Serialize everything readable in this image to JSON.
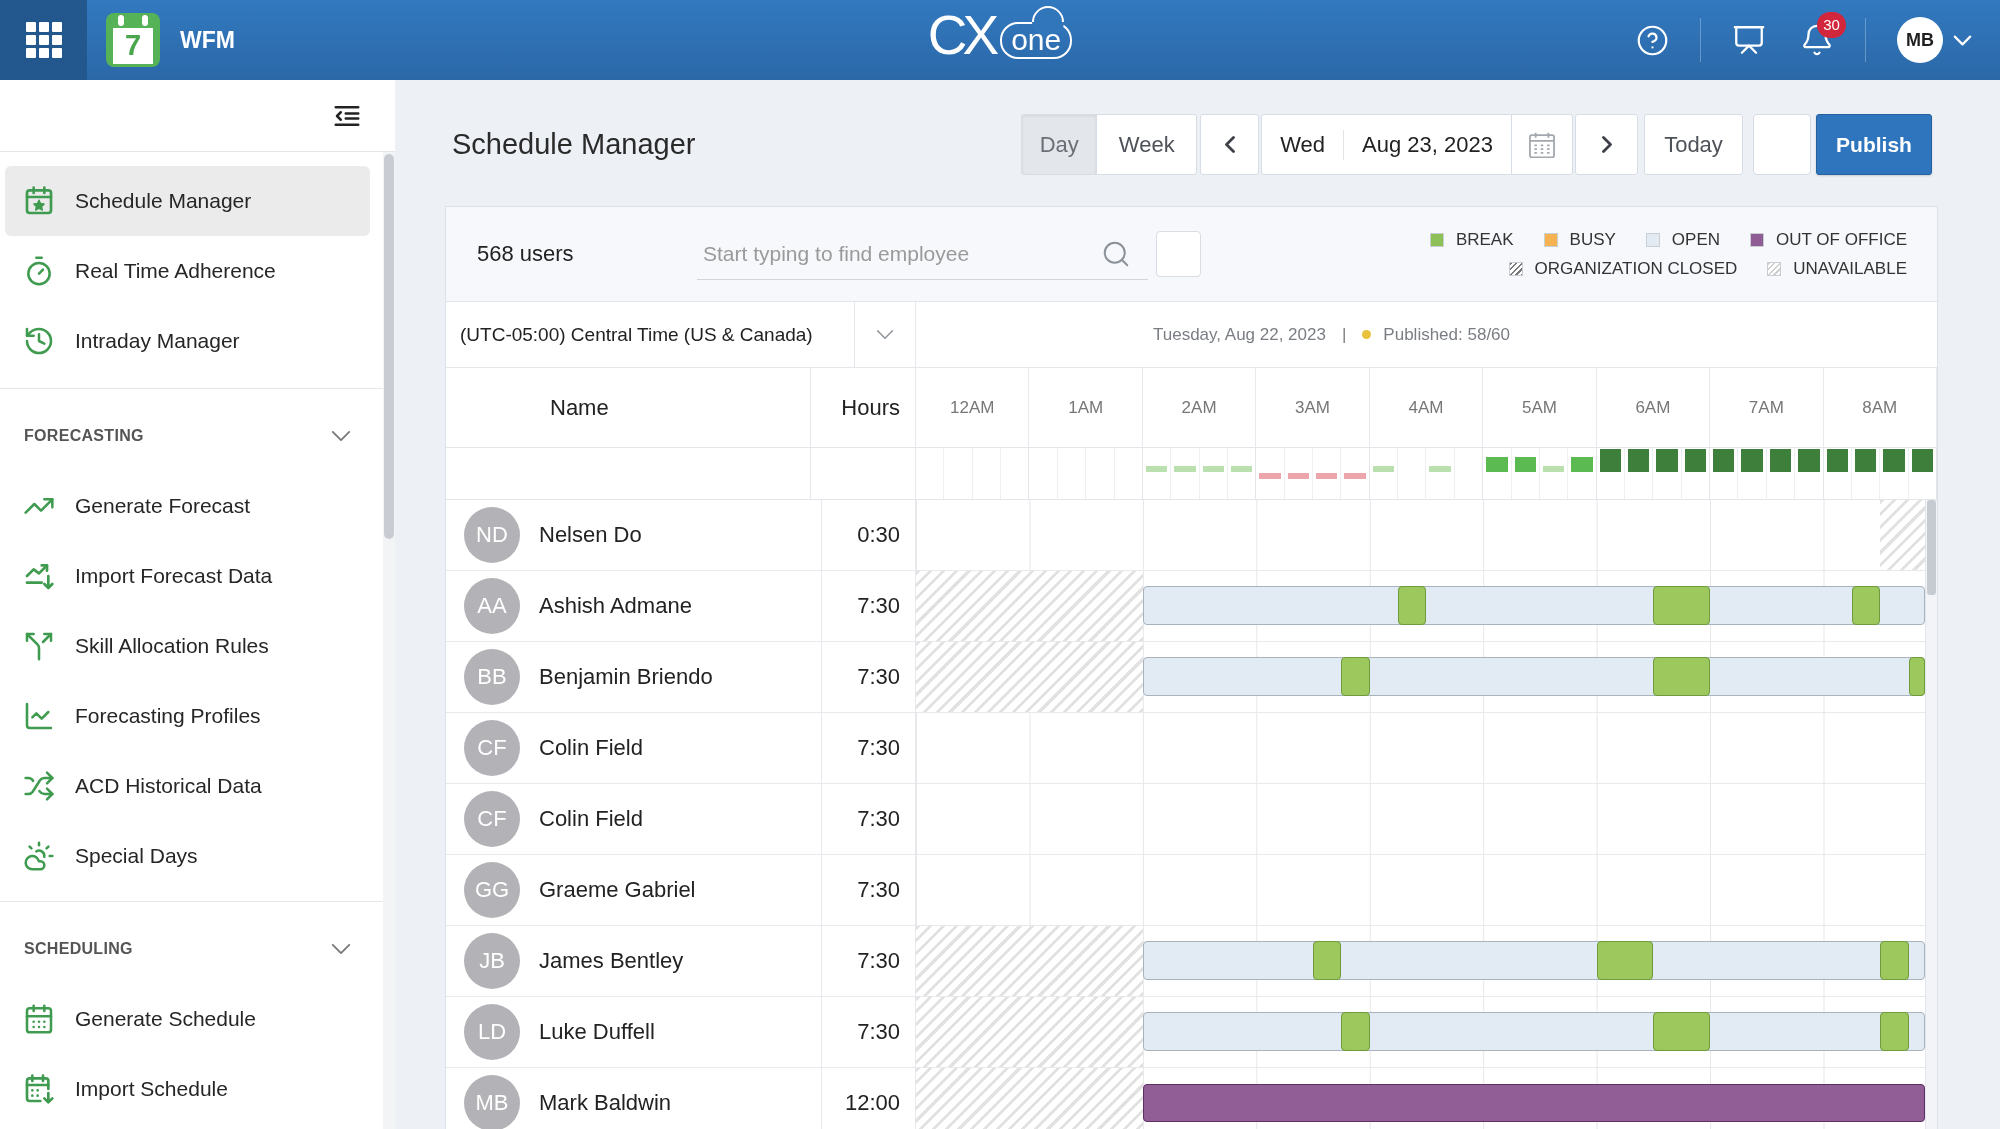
{
  "top_bar": {
    "app_day": "7",
    "app_name": "WFM",
    "logo": {
      "main": "CX",
      "suffix": "one"
    },
    "notifications": "30",
    "user_initials": "MB"
  },
  "sidebar": {
    "items": [
      {
        "label": "Schedule Manager",
        "selected": true
      },
      {
        "label": "Real Time Adherence",
        "selected": false
      },
      {
        "label": "Intraday Manager",
        "selected": false
      }
    ],
    "sections": [
      {
        "title": "FORECASTING",
        "expanded": true,
        "items": [
          {
            "label": "Generate Forecast",
            "selected": false
          },
          {
            "label": "Import Forecast Data",
            "selected": false
          },
          {
            "label": "Skill Allocation Rules",
            "selected": false
          },
          {
            "label": "Forecasting Profiles",
            "selected": false
          },
          {
            "label": "ACD Historical Data",
            "selected": false
          },
          {
            "label": "Special Days",
            "selected": false
          }
        ]
      },
      {
        "title": "SCHEDULING",
        "expanded": true,
        "items": [
          {
            "label": "Generate Schedule",
            "selected": false
          },
          {
            "label": "Import Schedule",
            "selected": false
          }
        ]
      }
    ]
  },
  "page_title": "Schedule Manager",
  "toolbar": {
    "views": [
      {
        "label": "Day",
        "selected": true
      },
      {
        "label": "Week",
        "selected": false
      }
    ],
    "weekday": "Wed",
    "date": "Aug 23, 2023",
    "today": "Today",
    "publish": "Publish"
  },
  "panel": {
    "users_count": "568 users",
    "search": {
      "placeholder": "Start typing to find employee"
    },
    "legend": [
      {
        "label": "BREAK",
        "kind": "solid",
        "color": "#8dc057"
      },
      {
        "label": "BUSY",
        "kind": "solid",
        "color": "#f4b350"
      },
      {
        "label": "OPEN",
        "kind": "solid",
        "color": "#e3eaf2"
      },
      {
        "label": "OUT OF OFFICE",
        "kind": "solid",
        "color": "#8f5c94"
      },
      {
        "label": "ORGANIZATION CLOSED",
        "kind": "hatched",
        "color": "#7a7a7a"
      },
      {
        "label": "UNAVAILABLE",
        "kind": "hatched",
        "color": "#cfcfcf"
      }
    ],
    "timezone": {
      "value": "(UTC-05:00) Central Time (US & Canada)"
    },
    "schedule_date": "Tuesday, Aug 22, 2023",
    "separator": "|",
    "published": "Published: 58/60",
    "columns": {
      "name": "Name",
      "hours": "Hours"
    },
    "hour_labels": [
      "12AM",
      "1AM",
      "2AM",
      "3AM",
      "4AM",
      "5AM",
      "6AM",
      "7AM",
      "8AM"
    ],
    "coverage": [
      {
        "kind": "none"
      },
      {
        "kind": "none"
      },
      {
        "kind": "none"
      },
      {
        "kind": "none"
      },
      {
        "kind": "none"
      },
      {
        "kind": "none"
      },
      {
        "kind": "none"
      },
      {
        "kind": "none"
      },
      {
        "kind": "light"
      },
      {
        "kind": "light"
      },
      {
        "kind": "light"
      },
      {
        "kind": "light"
      },
      {
        "kind": "low"
      },
      {
        "kind": "low"
      },
      {
        "kind": "low"
      },
      {
        "kind": "low"
      },
      {
        "kind": "light"
      },
      {
        "kind": "none"
      },
      {
        "kind": "light"
      },
      {
        "kind": "none"
      },
      {
        "kind": "medium"
      },
      {
        "kind": "medium"
      },
      {
        "kind": "light"
      },
      {
        "kind": "medium"
      },
      {
        "kind": "full"
      },
      {
        "kind": "full"
      },
      {
        "kind": "full"
      },
      {
        "kind": "full"
      },
      {
        "kind": "full"
      },
      {
        "kind": "full"
      },
      {
        "kind": "full"
      },
      {
        "kind": "full"
      },
      {
        "kind": "full"
      },
      {
        "kind": "full"
      },
      {
        "kind": "full"
      },
      {
        "kind": "full"
      }
    ],
    "employees": [
      {
        "initials": "ND",
        "name": "Nelsen Do",
        "hours": "0:30",
        "slots": [
          {
            "kind": "none"
          },
          {
            "kind": "none"
          },
          {
            "kind": "none"
          },
          {
            "kind": "none"
          },
          {
            "kind": "none"
          },
          {
            "kind": "none"
          },
          {
            "kind": "none"
          },
          {
            "kind": "none"
          },
          {
            "kind": "none"
          },
          {
            "kind": "none"
          },
          {
            "kind": "none"
          },
          {
            "kind": "none"
          },
          {
            "kind": "none"
          },
          {
            "kind": "none"
          },
          {
            "kind": "none"
          },
          {
            "kind": "none"
          },
          {
            "kind": "none"
          },
          {
            "kind": "none"
          },
          {
            "kind": "none"
          },
          {
            "kind": "none"
          },
          {
            "kind": "none"
          },
          {
            "kind": "none"
          },
          {
            "kind": "none"
          },
          {
            "kind": "none"
          },
          {
            "kind": "none"
          },
          {
            "kind": "none"
          },
          {
            "kind": "none"
          },
          {
            "kind": "none"
          },
          {
            "kind": "none"
          },
          {
            "kind": "none"
          },
          {
            "kind": "none"
          },
          {
            "kind": "none"
          },
          {
            "kind": "none"
          },
          {
            "kind": "none"
          },
          {
            "kind": "unavailable"
          },
          {
            "kind": "unavailable"
          }
        ]
      },
      {
        "initials": "AA",
        "name": "Ashish Admane",
        "hours": "7:30",
        "slots": [
          {
            "kind": "unavailable"
          },
          {
            "kind": "unavailable"
          },
          {
            "kind": "unavailable"
          },
          {
            "kind": "unavailable"
          },
          {
            "kind": "unavailable"
          },
          {
            "kind": "unavailable"
          },
          {
            "kind": "unavailable"
          },
          {
            "kind": "unavailable"
          },
          {
            "kind": "open"
          },
          {
            "kind": "open"
          },
          {
            "kind": "open"
          },
          {
            "kind": "open"
          },
          {
            "kind": "open"
          },
          {
            "kind": "open"
          },
          {
            "kind": "open"
          },
          {
            "kind": "open"
          },
          {
            "kind": "open"
          },
          {
            "kind": "break"
          },
          {
            "kind": "open"
          },
          {
            "kind": "open"
          },
          {
            "kind": "open"
          },
          {
            "kind": "open"
          },
          {
            "kind": "open"
          },
          {
            "kind": "open"
          },
          {
            "kind": "open"
          },
          {
            "kind": "open"
          },
          {
            "kind": "break"
          },
          {
            "kind": "break"
          },
          {
            "kind": "open"
          },
          {
            "kind": "open"
          },
          {
            "kind": "open"
          },
          {
            "kind": "open"
          },
          {
            "kind": "open"
          },
          {
            "kind": "break"
          },
          {
            "kind": "open"
          },
          {
            "kind": "open"
          }
        ]
      },
      {
        "initials": "BB",
        "name": "Benjamin Briendo",
        "hours": "7:30",
        "slots": [
          {
            "kind": "unavailable"
          },
          {
            "kind": "unavailable"
          },
          {
            "kind": "unavailable"
          },
          {
            "kind": "unavailable"
          },
          {
            "kind": "unavailable"
          },
          {
            "kind": "unavailable"
          },
          {
            "kind": "unavailable"
          },
          {
            "kind": "unavailable"
          },
          {
            "kind": "open"
          },
          {
            "kind": "open"
          },
          {
            "kind": "open"
          },
          {
            "kind": "open"
          },
          {
            "kind": "open"
          },
          {
            "kind": "open"
          },
          {
            "kind": "open"
          },
          {
            "kind": "break"
          },
          {
            "kind": "open"
          },
          {
            "kind": "open"
          },
          {
            "kind": "open"
          },
          {
            "kind": "open"
          },
          {
            "kind": "open"
          },
          {
            "kind": "open"
          },
          {
            "kind": "open"
          },
          {
            "kind": "open"
          },
          {
            "kind": "open"
          },
          {
            "kind": "open"
          },
          {
            "kind": "break"
          },
          {
            "kind": "break"
          },
          {
            "kind": "open"
          },
          {
            "kind": "open"
          },
          {
            "kind": "open"
          },
          {
            "kind": "open"
          },
          {
            "kind": "open"
          },
          {
            "kind": "open"
          },
          {
            "kind": "open"
          },
          {
            "kind": "break"
          }
        ]
      },
      {
        "initials": "CF",
        "name": "Colin Field",
        "hours": "7:30",
        "slots": [
          {
            "kind": "none"
          },
          {
            "kind": "none"
          },
          {
            "kind": "none"
          },
          {
            "kind": "none"
          },
          {
            "kind": "none"
          },
          {
            "kind": "none"
          },
          {
            "kind": "none"
          },
          {
            "kind": "none"
          },
          {
            "kind": "none"
          },
          {
            "kind": "none"
          },
          {
            "kind": "none"
          },
          {
            "kind": "none"
          },
          {
            "kind": "none"
          },
          {
            "kind": "none"
          },
          {
            "kind": "none"
          },
          {
            "kind": "none"
          },
          {
            "kind": "none"
          },
          {
            "kind": "none"
          },
          {
            "kind": "none"
          },
          {
            "kind": "none"
          },
          {
            "kind": "none"
          },
          {
            "kind": "none"
          },
          {
            "kind": "none"
          },
          {
            "kind": "none"
          },
          {
            "kind": "none"
          },
          {
            "kind": "none"
          },
          {
            "kind": "none"
          },
          {
            "kind": "none"
          },
          {
            "kind": "none"
          },
          {
            "kind": "none"
          },
          {
            "kind": "none"
          },
          {
            "kind": "none"
          },
          {
            "kind": "none"
          },
          {
            "kind": "none"
          },
          {
            "kind": "none"
          },
          {
            "kind": "none"
          }
        ]
      },
      {
        "initials": "CF",
        "name": "Colin Field",
        "hours": "7:30",
        "slots": [
          {
            "kind": "none"
          },
          {
            "kind": "none"
          },
          {
            "kind": "none"
          },
          {
            "kind": "none"
          },
          {
            "kind": "none"
          },
          {
            "kind": "none"
          },
          {
            "kind": "none"
          },
          {
            "kind": "none"
          },
          {
            "kind": "none"
          },
          {
            "kind": "none"
          },
          {
            "kind": "none"
          },
          {
            "kind": "none"
          },
          {
            "kind": "none"
          },
          {
            "kind": "none"
          },
          {
            "kind": "none"
          },
          {
            "kind": "none"
          },
          {
            "kind": "none"
          },
          {
            "kind": "none"
          },
          {
            "kind": "none"
          },
          {
            "kind": "none"
          },
          {
            "kind": "none"
          },
          {
            "kind": "none"
          },
          {
            "kind": "none"
          },
          {
            "kind": "none"
          },
          {
            "kind": "none"
          },
          {
            "kind": "none"
          },
          {
            "kind": "none"
          },
          {
            "kind": "none"
          },
          {
            "kind": "none"
          },
          {
            "kind": "none"
          },
          {
            "kind": "none"
          },
          {
            "kind": "none"
          },
          {
            "kind": "none"
          },
          {
            "kind": "none"
          },
          {
            "kind": "none"
          },
          {
            "kind": "none"
          }
        ]
      },
      {
        "initials": "GG",
        "name": "Graeme Gabriel",
        "hours": "7:30",
        "slots": [
          {
            "kind": "none"
          },
          {
            "kind": "none"
          },
          {
            "kind": "none"
          },
          {
            "kind": "none"
          },
          {
            "kind": "none"
          },
          {
            "kind": "none"
          },
          {
            "kind": "none"
          },
          {
            "kind": "none"
          },
          {
            "kind": "none"
          },
          {
            "kind": "none"
          },
          {
            "kind": "none"
          },
          {
            "kind": "none"
          },
          {
            "kind": "none"
          },
          {
            "kind": "none"
          },
          {
            "kind": "none"
          },
          {
            "kind": "none"
          },
          {
            "kind": "none"
          },
          {
            "kind": "none"
          },
          {
            "kind": "none"
          },
          {
            "kind": "none"
          },
          {
            "kind": "none"
          },
          {
            "kind": "none"
          },
          {
            "kind": "none"
          },
          {
            "kind": "none"
          },
          {
            "kind": "none"
          },
          {
            "kind": "none"
          },
          {
            "kind": "none"
          },
          {
            "kind": "none"
          },
          {
            "kind": "none"
          },
          {
            "kind": "none"
          },
          {
            "kind": "none"
          },
          {
            "kind": "none"
          },
          {
            "kind": "none"
          },
          {
            "kind": "none"
          },
          {
            "kind": "none"
          },
          {
            "kind": "none"
          }
        ]
      },
      {
        "initials": "JB",
        "name": "James Bentley",
        "hours": "7:30",
        "slots": [
          {
            "kind": "unavailable"
          },
          {
            "kind": "unavailable"
          },
          {
            "kind": "unavailable"
          },
          {
            "kind": "unavailable"
          },
          {
            "kind": "unavailable"
          },
          {
            "kind": "unavailable"
          },
          {
            "kind": "unavailable"
          },
          {
            "kind": "unavailable"
          },
          {
            "kind": "open"
          },
          {
            "kind": "open"
          },
          {
            "kind": "open"
          },
          {
            "kind": "open"
          },
          {
            "kind": "open"
          },
          {
            "kind": "open"
          },
          {
            "kind": "break"
          },
          {
            "kind": "open"
          },
          {
            "kind": "open"
          },
          {
            "kind": "open"
          },
          {
            "kind": "open"
          },
          {
            "kind": "open"
          },
          {
            "kind": "open"
          },
          {
            "kind": "open"
          },
          {
            "kind": "open"
          },
          {
            "kind": "open"
          },
          {
            "kind": "break"
          },
          {
            "kind": "break"
          },
          {
            "kind": "open"
          },
          {
            "kind": "open"
          },
          {
            "kind": "open"
          },
          {
            "kind": "open"
          },
          {
            "kind": "open"
          },
          {
            "kind": "open"
          },
          {
            "kind": "open"
          },
          {
            "kind": "open"
          },
          {
            "kind": "break"
          },
          {
            "kind": "open"
          }
        ]
      },
      {
        "initials": "LD",
        "name": "Luke Duffell",
        "hours": "7:30",
        "slots": [
          {
            "kind": "unavailable"
          },
          {
            "kind": "unavailable"
          },
          {
            "kind": "unavailable"
          },
          {
            "kind": "unavailable"
          },
          {
            "kind": "unavailable"
          },
          {
            "kind": "unavailable"
          },
          {
            "kind": "unavailable"
          },
          {
            "kind": "unavailable"
          },
          {
            "kind": "open"
          },
          {
            "kind": "open"
          },
          {
            "kind": "open"
          },
          {
            "kind": "open"
          },
          {
            "kind": "open"
          },
          {
            "kind": "open"
          },
          {
            "kind": "open"
          },
          {
            "kind": "break"
          },
          {
            "kind": "open"
          },
          {
            "kind": "open"
          },
          {
            "kind": "open"
          },
          {
            "kind": "open"
          },
          {
            "kind": "open"
          },
          {
            "kind": "open"
          },
          {
            "kind": "open"
          },
          {
            "kind": "open"
          },
          {
            "kind": "open"
          },
          {
            "kind": "open"
          },
          {
            "kind": "break"
          },
          {
            "kind": "break"
          },
          {
            "kind": "open"
          },
          {
            "kind": "open"
          },
          {
            "kind": "open"
          },
          {
            "kind": "open"
          },
          {
            "kind": "open"
          },
          {
            "kind": "open"
          },
          {
            "kind": "break"
          },
          {
            "kind": "open"
          }
        ]
      },
      {
        "initials": "MB",
        "name": "Mark Baldwin",
        "hours": "12:00",
        "slots": [
          {
            "kind": "unavailable"
          },
          {
            "kind": "unavailable"
          },
          {
            "kind": "unavailable"
          },
          {
            "kind": "unavailable"
          },
          {
            "kind": "unavailable"
          },
          {
            "kind": "unavailable"
          },
          {
            "kind": "unavailable"
          },
          {
            "kind": "unavailable"
          },
          {
            "kind": "away"
          },
          {
            "kind": "away"
          },
          {
            "kind": "away"
          },
          {
            "kind": "away"
          },
          {
            "kind": "away"
          },
          {
            "kind": "away"
          },
          {
            "kind": "away"
          },
          {
            "kind": "away"
          },
          {
            "kind": "away"
          },
          {
            "kind": "away"
          },
          {
            "kind": "away"
          },
          {
            "kind": "away"
          },
          {
            "kind": "away"
          },
          {
            "kind": "away"
          },
          {
            "kind": "away"
          },
          {
            "kind": "away"
          },
          {
            "kind": "away"
          },
          {
            "kind": "away"
          },
          {
            "kind": "away"
          },
          {
            "kind": "away"
          },
          {
            "kind": "away"
          },
          {
            "kind": "away"
          },
          {
            "kind": "away"
          },
          {
            "kind": "away"
          },
          {
            "kind": "away"
          },
          {
            "kind": "away"
          },
          {
            "kind": "away"
          },
          {
            "kind": "away"
          }
        ]
      }
    ]
  }
}
